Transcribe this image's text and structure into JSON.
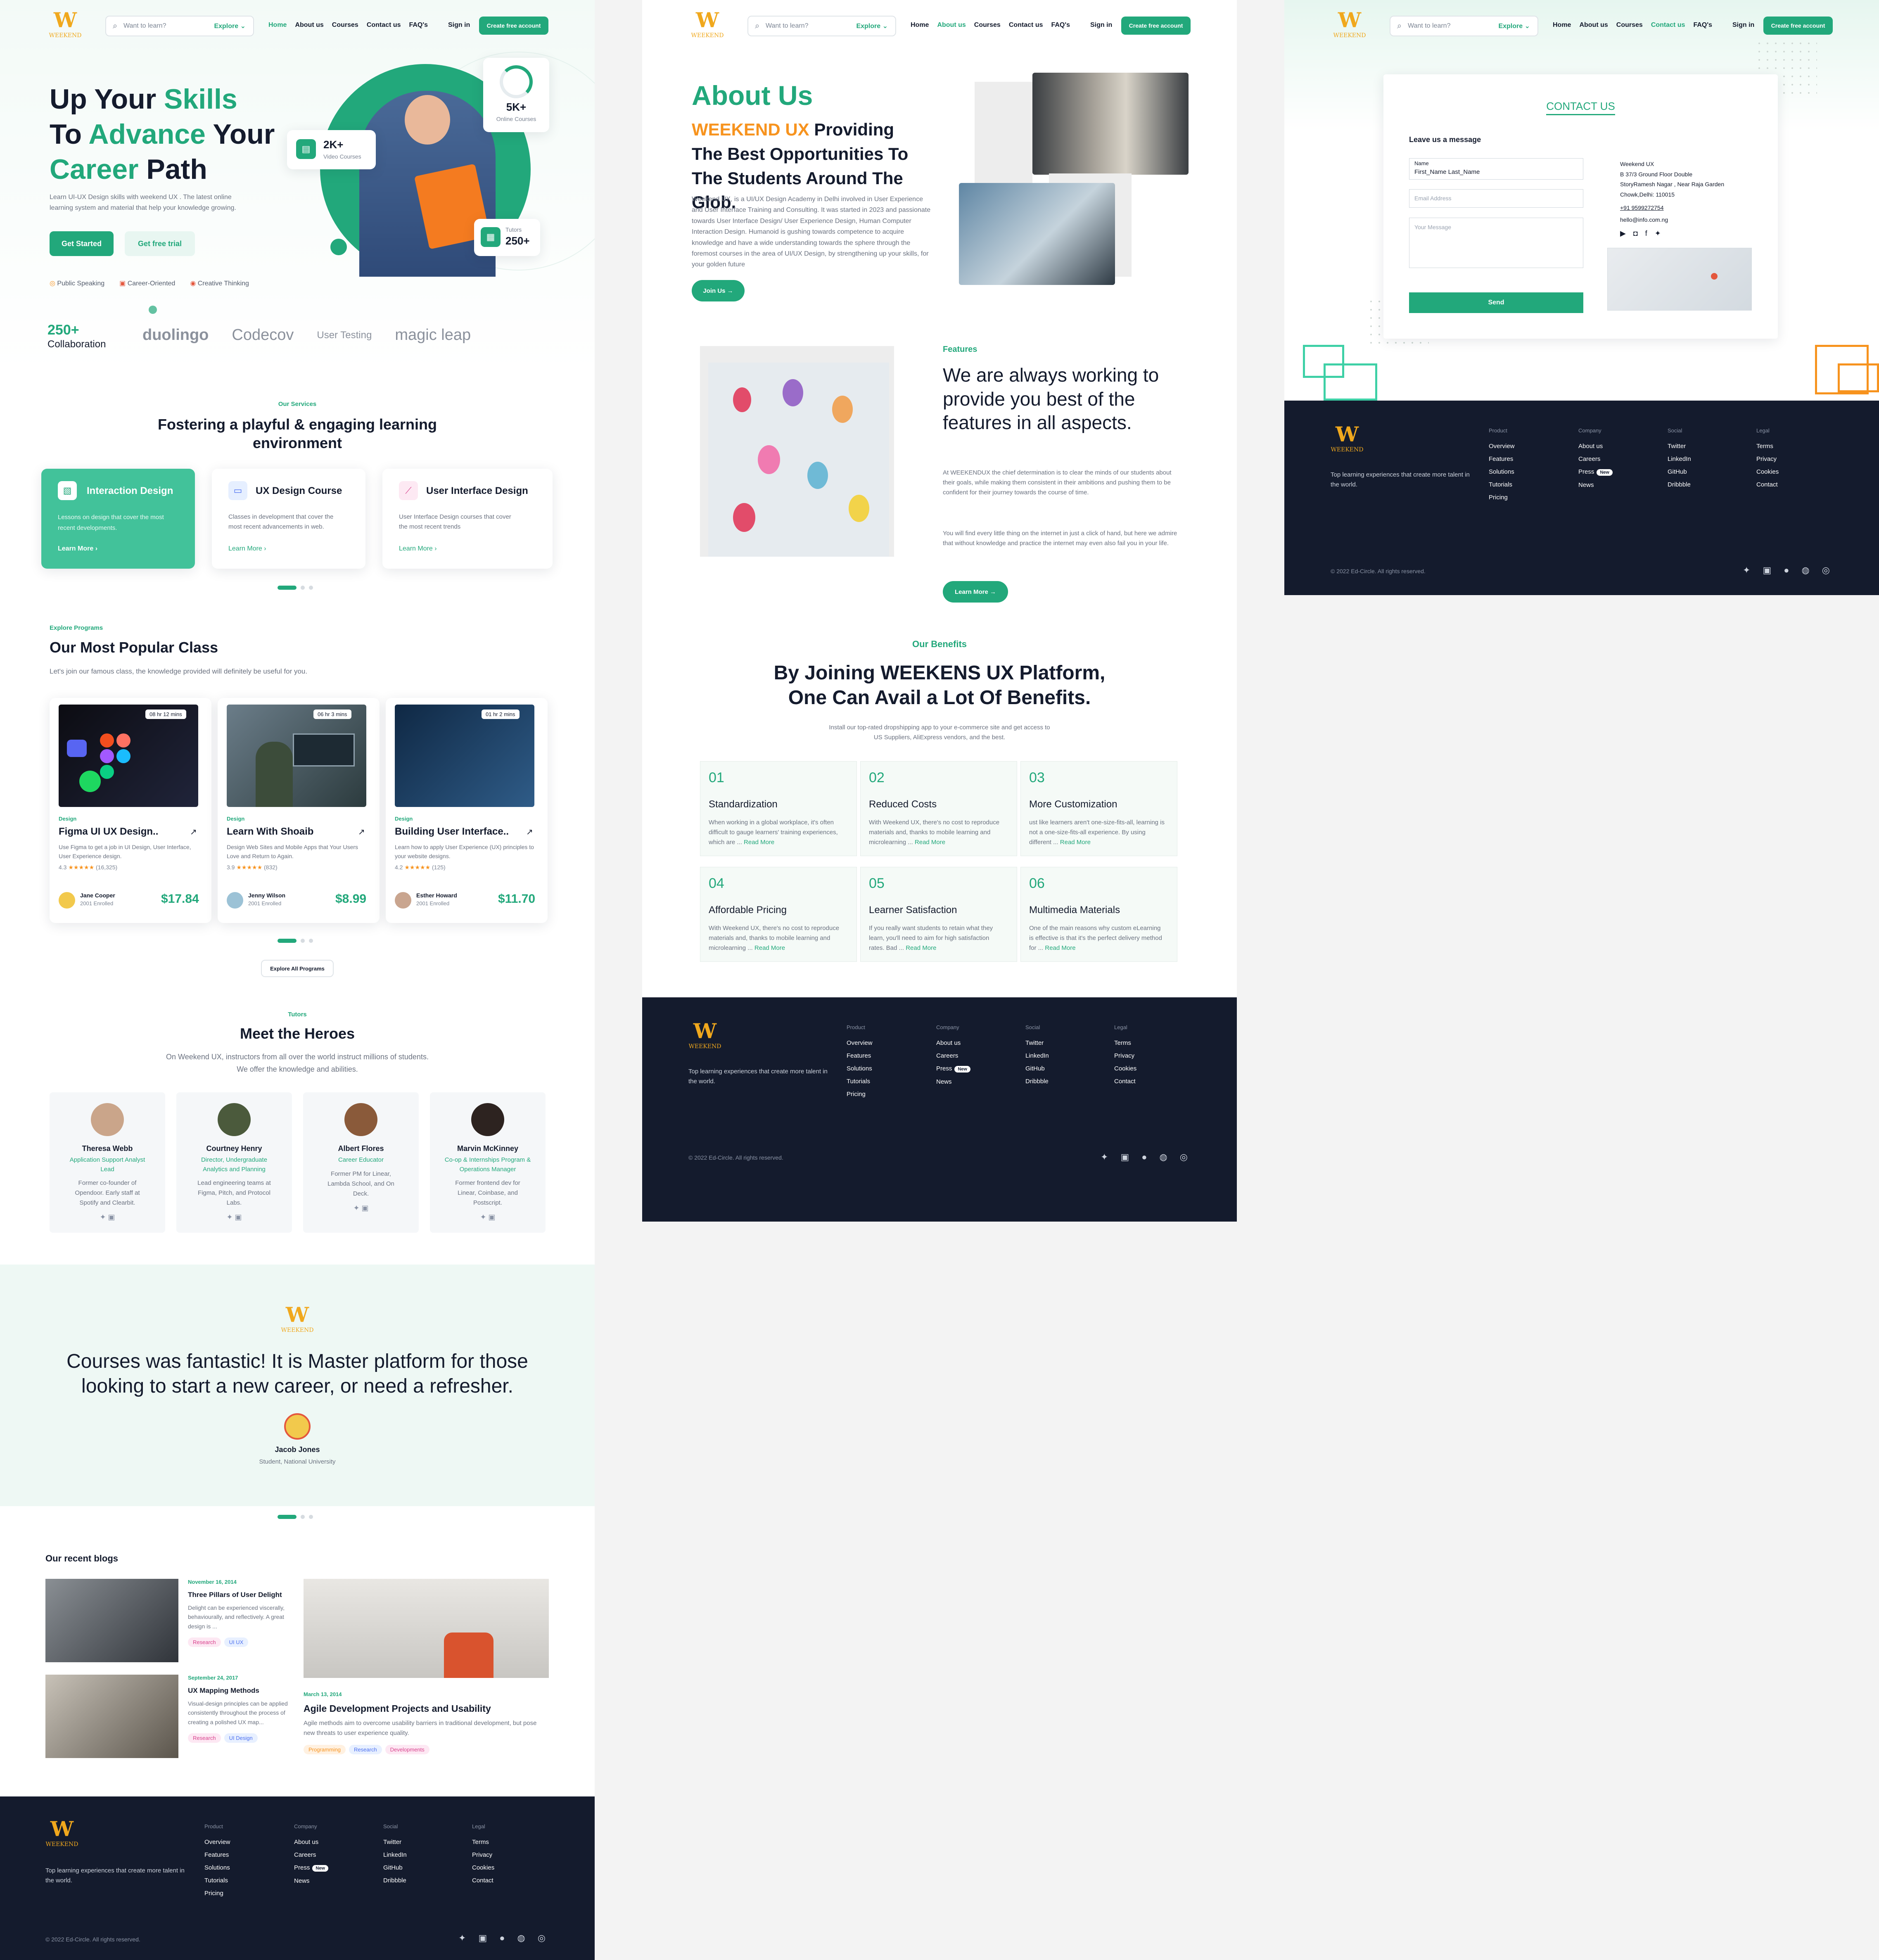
{
  "brand": {
    "logo_mark": "W",
    "logo_text": "WEEKEND"
  },
  "nav": {
    "search_placeholder": "Want to learn?",
    "explore": "Explore ⌄",
    "links": [
      "Home",
      "About us",
      "Courses",
      "Contact us",
      "FAQ's"
    ],
    "signin": "Sign in",
    "cta": "Create free account"
  },
  "home": {
    "hero": {
      "title_1a": "Up Your ",
      "title_1b": "Skills",
      "title_2a": "To ",
      "title_2b": "Advance",
      "title_2c": " Your",
      "title_3a": "Career",
      "title_3b": " Path",
      "desc": "Learn UI-UX Design skills with weekend UX . The latest online learning system and material that help your knowledge growing.",
      "btn_start": "Get Started",
      "btn_trial": "Get free trial",
      "features": [
        "Public Speaking",
        "Career-Oriented",
        "Creative Thinking"
      ],
      "stat_video_num": "2K+",
      "stat_video_lbl": "Video Courses",
      "stat_online_num": "5K+",
      "stat_online_lbl": "Online Courses",
      "stat_tutors_lbl": "Tutors",
      "stat_tutors_num": "250+",
      "collab_num": "250+",
      "collab_lbl": "Collaboration",
      "partners": [
        "duolingo",
        "Codecov",
        "User Testing",
        "magic leap"
      ]
    },
    "services": {
      "eyebrow": "Our Services",
      "title": "Fostering a playful & engaging learning environment",
      "cards": [
        {
          "title": "Interaction Design",
          "desc": "Lessons on design that cover the most recent developments.",
          "link": "Learn More ›"
        },
        {
          "title": "UX Design Course",
          "desc": "Classes in development that cover the most recent advancements in web.",
          "link": "Learn More ›"
        },
        {
          "title": "User Interface Design",
          "desc": "User Interface Design courses that cover the most recent  trends",
          "link": "Learn More ›"
        }
      ]
    },
    "popular": {
      "eyebrow": "Explore Programs",
      "title": "Our Most Popular Class",
      "sub": "Let's join our famous class, the knowledge provided will definitely be useful for you.",
      "cards": [
        {
          "duration": "08 hr 12 mins",
          "category": "Design",
          "title": "Figma UI UX Design..",
          "desc": "Use Figma to get a job in UI Design, User Interface, User Experience design.",
          "rating": "4.3",
          "reviews": "(16,325)",
          "author": "Jane Cooper",
          "enrolled": "2001 Enrolled",
          "price": "$17.84"
        },
        {
          "duration": "06 hr 3 mins",
          "category": "Design",
          "title": "Learn With Shoaib",
          "desc": "Design Web Sites and Mobile Apps that Your Users Love and Return to Again.",
          "rating": "3.9",
          "reviews": "(832)",
          "author": "Jenny Wilson",
          "enrolled": "2001 Enrolled",
          "price": "$8.99"
        },
        {
          "duration": "01 hr 2 mins",
          "category": "Design",
          "title": "Building User Interface..",
          "desc": "Learn how to apply User Experience (UX) principles to your website designs.",
          "rating": "4.2",
          "reviews": "(125)",
          "author": "Esther Howard",
          "enrolled": "2001 Enrolled",
          "price": "$11.70"
        }
      ],
      "stars": "★★★★★",
      "explore_btn": "Explore All Programs"
    },
    "heroes": {
      "eyebrow": "Tutors",
      "title": "Meet the Heroes",
      "sub1": "On Weekend UX, instructors from all over the world instruct millions of students.",
      "sub2": "We offer the knowledge and abilities.",
      "tutors": [
        {
          "name": "Theresa Webb",
          "role": "Application Support Analyst Lead",
          "bio": "Former co-founder of Opendoor. Early staff at Spotify and Clearbit."
        },
        {
          "name": "Courtney Henry",
          "role": "Director, Undergraduate Analytics and Planning",
          "bio": "Lead engineering teams at Figma, Pitch, and Protocol Labs."
        },
        {
          "name": "Albert Flores",
          "role": "Career Educator",
          "bio": "Former PM for Linear, Lambda School, and On Deck."
        },
        {
          "name": "Marvin McKinney",
          "role": "Co-op & Internships Program & Operations Manager",
          "bio": "Former frontend dev for Linear, Coinbase, and Postscript."
        }
      ]
    },
    "testimonial": {
      "quote": "Courses was fantastic! It is Master platform for those looking to start a new career, or need a refresher.",
      "name": "Jacob Jones",
      "role": "Student, National University"
    },
    "blogs": {
      "title": "Our recent blogs",
      "items": [
        {
          "date": "November 16, 2014",
          "title": "Three Pillars of User Delight",
          "desc": "Delight can be experienced viscerally, behaviourally, and reflectively. A great design is ...",
          "tags": [
            "Research",
            "UI UX"
          ]
        },
        {
          "date": "September 24, 2017",
          "title": "UX Mapping Methods",
          "desc": "Visual-design principles can be applied consistently throughout the process of creating a polished UX map...",
          "tags": [
            "Research",
            "UI Design"
          ]
        },
        {
          "date": "March 13, 2014",
          "title": "Agile Development Projects and Usability",
          "desc": "Agile methods aim to overcome usability barriers in traditional development, but pose new threats to user experience quality.",
          "tags": [
            "Programming",
            "Research",
            "Developments"
          ]
        }
      ]
    }
  },
  "about": {
    "title": "About Us",
    "sub_a": "WEEKEND UX",
    "sub_b": " Providing The Best Opportunities To The Students Around The Glob.",
    "desc": "Weekend UX, is a UI/UX Design Academy in Delhi involved in User Experience and User Interface Training and Consulting. It was started in 2023 and passionate towards User Interface Design/ User Experience Design, Human Computer Interaction Design. Humanoid is gushing towards competence to acquire knowledge and have a wide understanding towards the sphere through the foremost courses in the area of UI/UX Design, by strengthening up your skills, for your golden future",
    "join": "Join Us →",
    "features_eyebrow": "Features",
    "features_title": "We are always working to provide you best of the features in all aspects.",
    "features_p1": "At WEEKENDUX the chief determination is to clear the minds of our students about their goals, while making them consistent in their ambitions and pushing them to be confident for their journey towards the course of time.",
    "features_p2": "You will find every little thing on the internet in just a click of hand, but here we admire that without knowledge and practice the internet may even also fail you in your life.",
    "learn": "Learn More →",
    "benefits_eyebrow": "Our Benefits",
    "benefits_title": "By Joining WEEKENS UX Platform, One Can Avail a Lot Of Benefits.",
    "benefits_sub": "Install our top-rated dropshipping app to your e-commerce site and get access to US Suppliers, AliExpress vendors, and the best.",
    "read_more": "Read More",
    "benefits": [
      {
        "num": "01",
        "title": "Standardization",
        "desc": "When working in a global workplace, it's often difficult to gauge learners' training experiences, which are ..."
      },
      {
        "num": "02",
        "title": "Reduced Costs",
        "desc": "With Weekend UX, there's no cost to reproduce materials and, thanks to mobile learning and microlearning ..."
      },
      {
        "num": "03",
        "title": "More Customization",
        "desc": "ust like learners aren't one-size-fits-all, learning is not a one-size-fits-all experience. By using different ..."
      },
      {
        "num": "04",
        "title": "Affordable Pricing",
        "desc": "With Weekend UX, there's no cost to reproduce materials and, thanks to mobile learning and microlearning ..."
      },
      {
        "num": "05",
        "title": "Learner Satisfaction",
        "desc": "If you really want students to retain what they learn, you'll need to aim for high satisfaction rates. Bad ..."
      },
      {
        "num": "06",
        "title": "Multimedia Materials",
        "desc": "One of the main reasons why custom eLearning is effective is that it's the perfect delivery method for ..."
      }
    ]
  },
  "contact": {
    "title": "CONTACT US",
    "leave": "Leave us a message",
    "name_label": "Name",
    "name_value": "First_Name Last_Name",
    "email_ph": "Email Address",
    "msg_ph": "Your Message",
    "send": "Send",
    "addr_1": "Weekend UX",
    "addr_2": "B 37/3 Ground Floor Double",
    "addr_3": "StoryRamesh Nagar , Near Raja Garden",
    "addr_4": "Chowk,Delhi: 110015",
    "phone": "+91 9599272754",
    "email": "hello@info.com.ng"
  },
  "footer": {
    "desc": "Top learning experiences that create more talent in the world.",
    "cols": [
      {
        "hd": "Product",
        "items": [
          "Overview",
          "Features",
          "Solutions",
          "Tutorials",
          "Pricing"
        ]
      },
      {
        "hd": "Company",
        "items": [
          "About us",
          "Careers",
          "Press",
          "News"
        ]
      },
      {
        "hd": "Social",
        "items": [
          "Twitter",
          "LinkedIn",
          "GitHub",
          "Dribbble"
        ]
      },
      {
        "hd": "Legal",
        "items": [
          "Terms",
          "Privacy",
          "Cookies",
          "Contact"
        ]
      }
    ],
    "new_badge": "New",
    "copy": "© 2022 Ed-Circle. All rights reserved."
  },
  "colors": {
    "accent": "#22a87b",
    "orange": "#f7931e",
    "dark": "#141b2d",
    "logo": "#f0a81d"
  }
}
